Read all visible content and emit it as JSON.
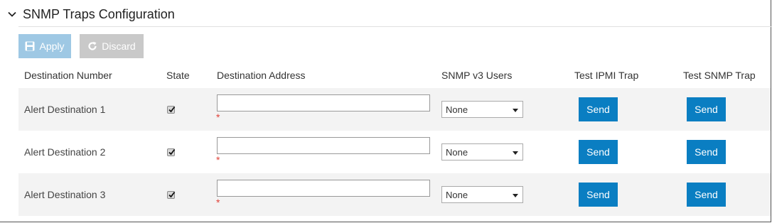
{
  "section": {
    "title": "SNMP Traps Configuration",
    "collapse_icon": "chevron-down-icon"
  },
  "toolbar": {
    "apply_label": "Apply",
    "apply_icon": "save-icon",
    "discard_label": "Discard",
    "discard_icon": "refresh-icon",
    "apply_color": "#9ec8e4",
    "discard_color": "#c9c9c9"
  },
  "columns": {
    "destination_number": "Destination Number",
    "state": "State",
    "destination_address": "Destination Address",
    "snmp_v3_users": "SNMP v3 Users",
    "test_ipmi_trap": "Test IPMI Trap",
    "test_snmp_trap": "Test SNMP Trap"
  },
  "rows": [
    {
      "label": "Alert Destination 1",
      "state_checked": true,
      "address": "",
      "required_marker": "*",
      "snmp_user": "None",
      "ipmi_button": "Send",
      "snmp_button": "Send"
    },
    {
      "label": "Alert Destination 2",
      "state_checked": true,
      "address": "",
      "required_marker": "*",
      "snmp_user": "None",
      "ipmi_button": "Send",
      "snmp_button": "Send"
    },
    {
      "label": "Alert Destination 3",
      "state_checked": true,
      "address": "",
      "required_marker": "*",
      "snmp_user": "None",
      "ipmi_button": "Send",
      "snmp_button": "Send"
    }
  ],
  "colors": {
    "send_button": "#0a7ec2",
    "required": "#e0433a",
    "row_shade": "#f3f3f3"
  }
}
